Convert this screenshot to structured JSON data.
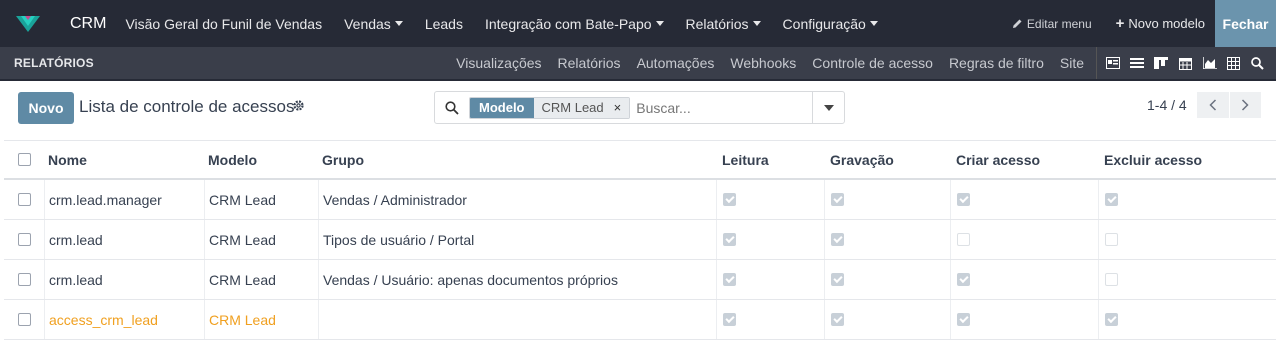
{
  "navbar": {
    "brand": "CRM",
    "menu": [
      {
        "label": "Visão Geral do Funil de Vendas",
        "dropdown": false
      },
      {
        "label": "Vendas",
        "dropdown": true
      },
      {
        "label": "Leads",
        "dropdown": false
      },
      {
        "label": "Integração com Bate-Papo",
        "dropdown": true
      },
      {
        "label": "Relatórios",
        "dropdown": true
      },
      {
        "label": "Configuração",
        "dropdown": true
      }
    ],
    "edit_menu": "Editar menu",
    "new_model": "Novo modelo",
    "close": "Fechar"
  },
  "subbar": {
    "title": "RELATÓRIOS",
    "links": [
      "Visualizações",
      "Relatórios",
      "Automações",
      "Webhooks",
      "Controle de acesso",
      "Regras de filtro",
      "Site"
    ],
    "view_icons": [
      "form-view-icon",
      "list-view-icon",
      "kanban-view-icon",
      "calendar-view-icon",
      "graph-view-icon",
      "pivot-view-icon",
      "search-view-icon"
    ]
  },
  "control": {
    "new_button": "Novo",
    "title": "Lista de controle de acessos",
    "search": {
      "facet_name": "Modelo",
      "facet_value": "CRM Lead",
      "placeholder": "Buscar..."
    },
    "pager": "1-4 / 4"
  },
  "table": {
    "columns": [
      "Nome",
      "Modelo",
      "Grupo",
      "Leitura",
      "Gravação",
      "Criar acesso",
      "Excluir acesso"
    ],
    "rows": [
      {
        "name": "crm.lead.manager",
        "model": "CRM Lead",
        "group": "Vendas / Administrador",
        "read": true,
        "write": true,
        "create": true,
        "unlink": true,
        "highlight": false
      },
      {
        "name": "crm.lead",
        "model": "CRM Lead",
        "group": "Tipos de usuário / Portal",
        "read": true,
        "write": true,
        "create": false,
        "unlink": false,
        "highlight": false
      },
      {
        "name": "crm.lead",
        "model": "CRM Lead",
        "group": "Vendas / Usuário: apenas documentos próprios",
        "read": true,
        "write": true,
        "create": true,
        "unlink": false,
        "highlight": false
      },
      {
        "name": "access_crm_lead",
        "model": "CRM Lead",
        "group": "",
        "read": true,
        "write": true,
        "create": true,
        "unlink": true,
        "highlight": true
      }
    ]
  },
  "colors": {
    "navbar": "#262a36",
    "subbar": "#3a3e4a",
    "primary": "#5f8aa5",
    "close_button": "#6b94ad",
    "warning_text": "#f0a020"
  }
}
